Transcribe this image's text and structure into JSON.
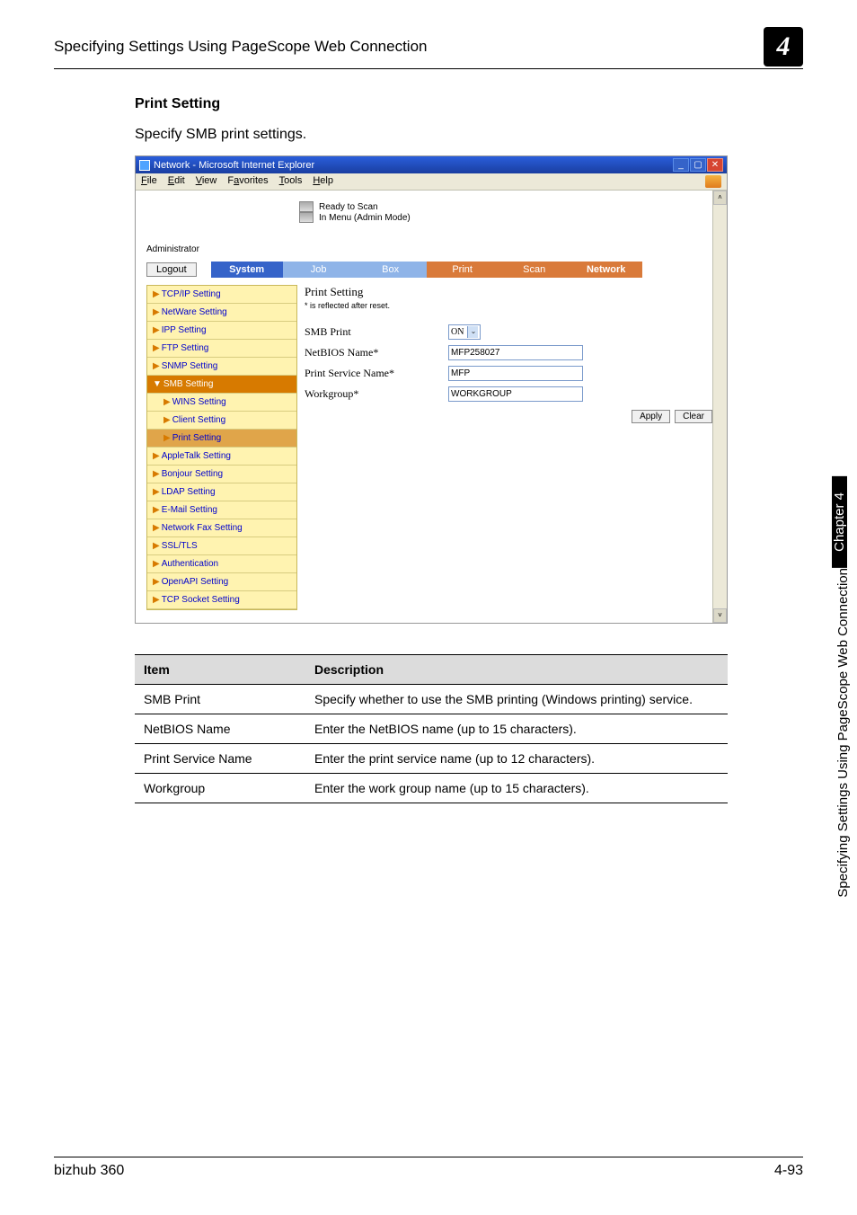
{
  "header": {
    "title": "Specifying Settings Using PageScope Web Connection",
    "chapter_number": "4"
  },
  "section": {
    "title": "Print Setting",
    "intro": "Specify SMB print settings."
  },
  "browser": {
    "title": "Network - Microsoft Internet Explorer",
    "menu": {
      "file": "File",
      "edit": "Edit",
      "view": "View",
      "favorites": "Favorites",
      "tools": "Tools",
      "help": "Help"
    },
    "status": {
      "line1": "Ready to Scan",
      "line2": "In Menu (Admin Mode)"
    },
    "admin_label": "Administrator",
    "logout": "Logout",
    "tabs": {
      "system": "System",
      "job": "Job",
      "box": "Box",
      "print": "Print",
      "scan": "Scan",
      "network": "Network"
    },
    "sidebar": {
      "tcpip": "TCP/IP Setting",
      "netware": "NetWare Setting",
      "ipp": "IPP Setting",
      "ftp": "FTP Setting",
      "snmp": "SNMP Setting",
      "smb": "SMB Setting",
      "wins": "WINS Setting",
      "client": "Client Setting",
      "print": "Print Setting",
      "appletalk": "AppleTalk Setting",
      "bonjour": "Bonjour Setting",
      "ldap": "LDAP Setting",
      "email": "E-Mail Setting",
      "netfax": "Network Fax Setting",
      "ssl": "SSL/TLS",
      "auth": "Authentication",
      "openapi": "OpenAPI Setting",
      "tcpsocket": "TCP Socket Setting"
    },
    "content": {
      "heading": "Print Setting",
      "note": "* is reflected after reset.",
      "rows": {
        "smb_print": {
          "label": "SMB Print",
          "value": "ON"
        },
        "netbios": {
          "label": "NetBIOS Name*",
          "value": "MFP258027"
        },
        "service": {
          "label": "Print Service Name*",
          "value": "MFP"
        },
        "workgroup": {
          "label": "Workgroup*",
          "value": "WORKGROUP"
        }
      },
      "apply": "Apply",
      "clear": "Clear"
    }
  },
  "table": {
    "head_item": "Item",
    "head_desc": "Description",
    "rows": [
      {
        "item": "SMB Print",
        "desc": "Specify whether to use the SMB printing (Windows printing) service."
      },
      {
        "item": "NetBIOS Name",
        "desc": "Enter the NetBIOS name (up to 15 characters)."
      },
      {
        "item": "Print Service Name",
        "desc": "Enter the print service name (up to 12 characters)."
      },
      {
        "item": "Workgroup",
        "desc": "Enter the work group name (up to 15 characters)."
      }
    ]
  },
  "side": {
    "chapter": "Chapter 4",
    "text": "Specifying Settings Using PageScope Web Connection"
  },
  "footer": {
    "left": "bizhub 360",
    "right": "4-93"
  }
}
